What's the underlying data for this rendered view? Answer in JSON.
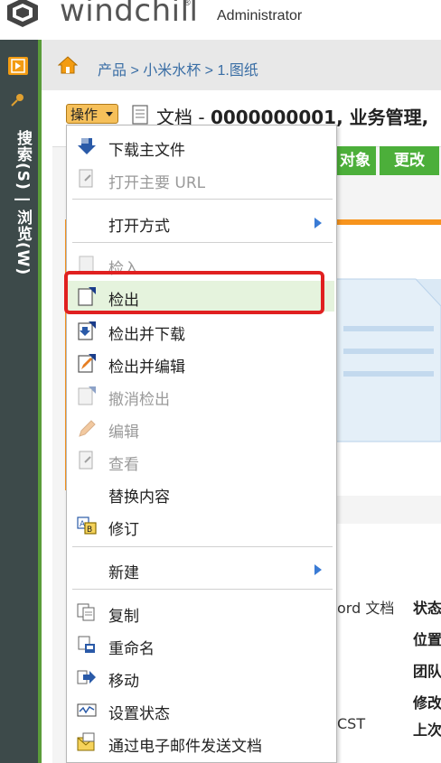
{
  "header": {
    "logo_text": "windchill",
    "logo_reg": "®",
    "user": "Administrator"
  },
  "leftnav": {
    "vertical_label": "搜索(S) | 浏览(W)"
  },
  "breadcrumb": {
    "text": "产品 > 小米水杯 > 1.图纸"
  },
  "toolbar": {
    "actions_label": "操作",
    "doc_title_prefix": "文档 - ",
    "doc_title_bold": "0000000001, 业务管理,"
  },
  "tabs": {
    "objects_label": "对象",
    "change_label": "更改"
  },
  "properties": {
    "type_value": "ord 文档",
    "time_value": "CST",
    "labels": [
      "状态",
      "位置",
      "团队",
      "修改",
      "上次"
    ]
  },
  "menu": {
    "items": [
      {
        "label": "下载主文件",
        "icon": "download-primary-icon",
        "disabled": false,
        "submenu": false
      },
      {
        "label": "打开主要 URL",
        "icon": "open-url-icon",
        "disabled": true,
        "submenu": false
      },
      {
        "label": "打开方式",
        "icon": "",
        "disabled": false,
        "submenu": true
      },
      {
        "label": "检入",
        "icon": "check-in-icon",
        "disabled": true,
        "submenu": false
      },
      {
        "label": "检出",
        "icon": "check-out-icon",
        "disabled": false,
        "submenu": false,
        "highlighted": true
      },
      {
        "label": "检出并下载",
        "icon": "check-out-download-icon",
        "disabled": false,
        "submenu": false
      },
      {
        "label": "检出并编辑",
        "icon": "check-out-edit-icon",
        "disabled": false,
        "submenu": false
      },
      {
        "label": "撤消检出",
        "icon": "undo-checkout-icon",
        "disabled": true,
        "submenu": false
      },
      {
        "label": "编辑",
        "icon": "edit-pencil-icon",
        "disabled": true,
        "submenu": false
      },
      {
        "label": "查看",
        "icon": "view-icon",
        "disabled": true,
        "submenu": false
      },
      {
        "label": "替换内容",
        "icon": "",
        "disabled": false,
        "submenu": false
      },
      {
        "label": "修订",
        "icon": "revise-icon",
        "disabled": false,
        "submenu": false
      },
      {
        "label": "新建",
        "icon": "",
        "disabled": false,
        "submenu": true
      },
      {
        "label": "复制",
        "icon": "copy-icon",
        "disabled": false,
        "submenu": false
      },
      {
        "label": "重命名",
        "icon": "rename-icon",
        "disabled": false,
        "submenu": false
      },
      {
        "label": "移动",
        "icon": "move-icon",
        "disabled": false,
        "submenu": false
      },
      {
        "label": "设置状态",
        "icon": "set-state-icon",
        "disabled": false,
        "submenu": false
      },
      {
        "label": "通过电子邮件发送文档",
        "icon": "email-document-icon",
        "disabled": false,
        "submenu": false
      }
    ]
  },
  "colors": {
    "nav_bg": "#3d4a4a",
    "accent_green": "#4caf3a",
    "accent_orange": "#f7941d",
    "highlight_red": "#e02020",
    "link_blue": "#3a6ea5"
  }
}
